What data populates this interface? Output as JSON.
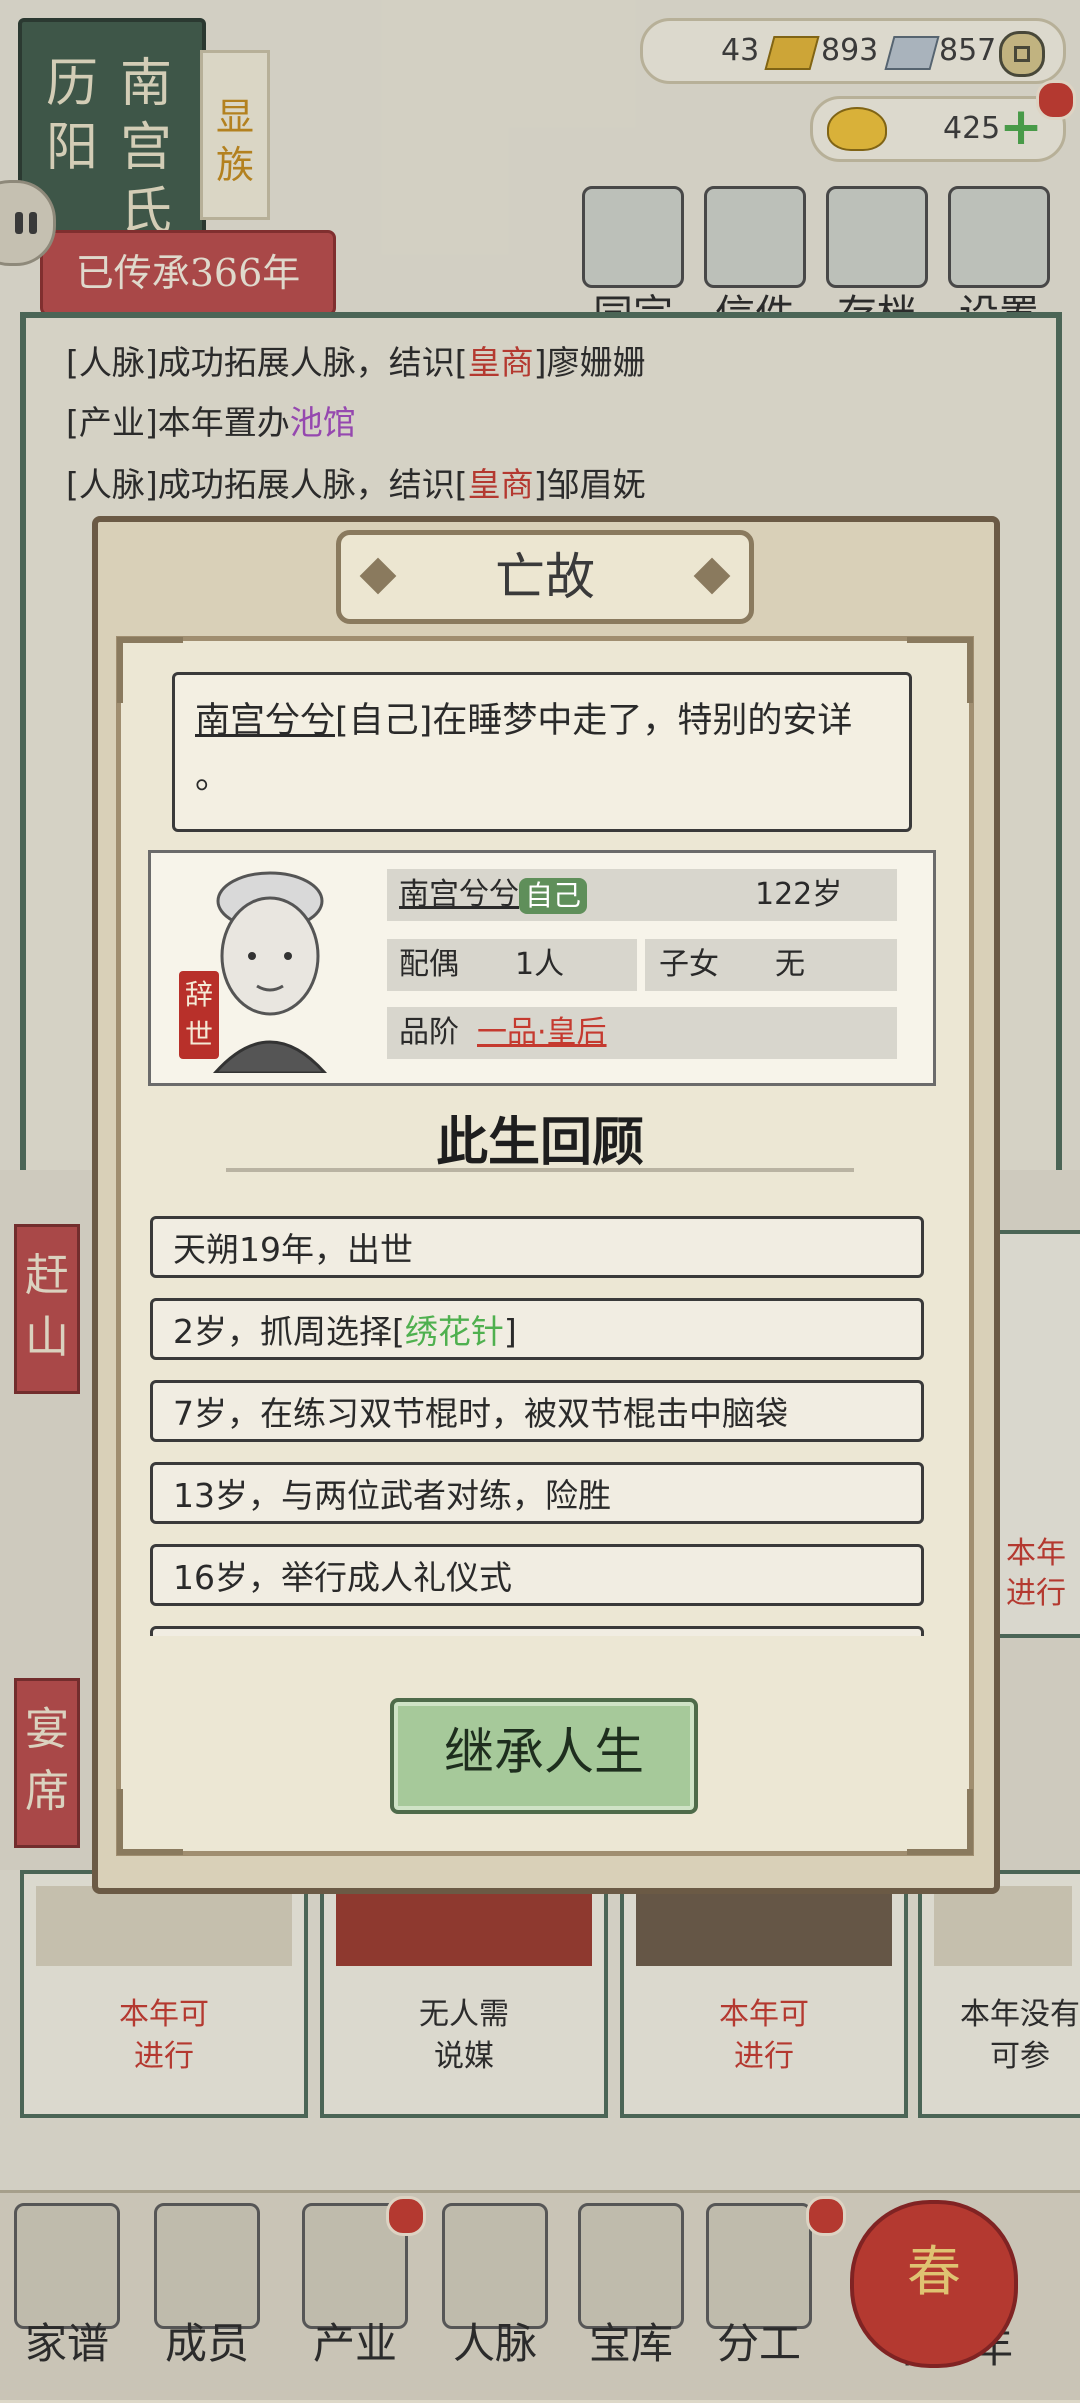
{
  "header": {
    "clan_name_col1": "历阳",
    "clan_name_col2": "南宫氏",
    "clan_rank": "显族",
    "inheritance": "已传承366年",
    "resources": {
      "gold": "43",
      "silver": "893",
      "coins": "857"
    },
    "ingots": "425",
    "nav": [
      {
        "label": "同宗",
        "icon": "clan-book-icon"
      },
      {
        "label": "信件",
        "icon": "letter-icon"
      },
      {
        "label": "存档",
        "icon": "save-scroll-icon"
      },
      {
        "label": "设置",
        "icon": "gear-icon"
      }
    ]
  },
  "log": {
    "line1": {
      "prefix": "[人脉]成功拓展人脉，结识[",
      "tag": "皇商",
      "suffix": "]廖姗姗"
    },
    "line2": {
      "prefix": "[产业]本年置办",
      "tag": "池馆"
    },
    "line3": {
      "prefix": "[人脉]成功拓展人脉，结识[",
      "tag": "皇商",
      "suffix": "]邹眉妩"
    }
  },
  "background": {
    "side_label_1": "赶山",
    "side_label_2": "宴席",
    "right_card_text": "本年\n进行",
    "cards": [
      {
        "text_1": "本年可",
        "text_2": "进行",
        "color": "#c53a2f"
      },
      {
        "text_1": "无人需",
        "text_2": "说媒",
        "color": "#2a2a2a"
      },
      {
        "text_1": "本年可",
        "text_2": "进行",
        "color": "#c53a2f"
      },
      {
        "text_1": "本年没有",
        "text_2": "可参",
        "color": "#2a2a2a"
      }
    ]
  },
  "bottom_nav": [
    {
      "label": "家谱",
      "icon": "genealogy-book-icon"
    },
    {
      "label": "成员",
      "icon": "member-icon"
    },
    {
      "label": "产业",
      "icon": "building-icon"
    },
    {
      "label": "人脉",
      "icon": "network-icon"
    },
    {
      "label": "宝库",
      "icon": "treasure-chest-icon"
    },
    {
      "label": "分工",
      "icon": "scroll-icon"
    },
    {
      "label": "下一年",
      "icon": "lantern-icon"
    }
  ],
  "next_year_glyph": "春",
  "modal": {
    "title": "亡故",
    "message": {
      "name": "南宫兮兮",
      "rest": "[自己]在睡梦中走了，特别的安详",
      "tail": "。"
    },
    "profile": {
      "name": "南宫兮兮",
      "badge": "自己",
      "age": "122岁",
      "spouse_label": "配偶",
      "spouse_value": "1人",
      "children_label": "子女",
      "children_value": "无",
      "rank_label": "品阶",
      "rank_value": "一品·皇后",
      "stamp": "辞世"
    },
    "review_title": "此生回顾",
    "events": [
      {
        "text": "天朔19年，出世"
      },
      {
        "prefix": "2岁，抓周选择[",
        "item": "绣花针",
        "suffix": "]"
      },
      {
        "text": "7岁，在练习双节棍时，被双节棍击中脑袋"
      },
      {
        "text": "13岁，与两位武者对练，险胜"
      },
      {
        "text": "16岁，举行成人礼仪式"
      }
    ],
    "action": "继承人生"
  },
  "colors": {
    "accent_red": "#c53a2f",
    "jade_green": "#4e6b5a",
    "item_green": "#4fb04f",
    "purple": "#a24ac0"
  }
}
